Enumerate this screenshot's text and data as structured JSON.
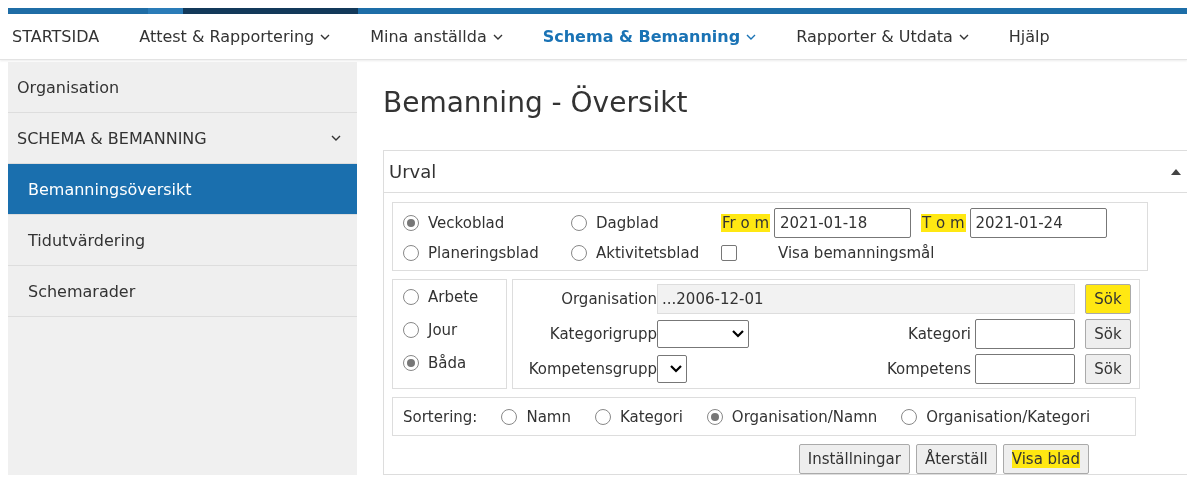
{
  "nav": [
    {
      "label": "STARTSIDA",
      "caret": false,
      "selected": false
    },
    {
      "label": "Attest & Rapportering",
      "caret": true,
      "selected": false
    },
    {
      "label": "Mina anställda",
      "caret": true,
      "selected": false
    },
    {
      "label": "Schema & Bemanning",
      "caret": true,
      "selected": true
    },
    {
      "label": "Rapporter & Utdata",
      "caret": true,
      "selected": false
    },
    {
      "label": "Hjälp",
      "caret": false,
      "selected": false
    }
  ],
  "sidebar": {
    "items": [
      {
        "label": "Organisation",
        "kind": "item",
        "selected": false
      },
      {
        "label": "SCHEMA & BEMANNING",
        "kind": "section",
        "expanded": true,
        "selected": false
      },
      {
        "label": "Bemanningsöversikt",
        "kind": "sub",
        "selected": true
      },
      {
        "label": "Tidutvärdering",
        "kind": "sub",
        "selected": false
      },
      {
        "label": "Schemarader",
        "kind": "sub",
        "selected": false
      }
    ]
  },
  "page_title": "Bemanning - Översikt",
  "panel": {
    "title": "Urval",
    "expanded": true,
    "sheet_types": [
      {
        "label": "Veckoblad",
        "selected": true
      },
      {
        "label": "Dagblad",
        "selected": false
      },
      {
        "label": "Planeringsblad",
        "selected": false
      },
      {
        "label": "Aktivitetsblad",
        "selected": false
      }
    ],
    "show_goal": {
      "label": "Visa bemanningsmål",
      "checked": false
    },
    "from": {
      "label": "Fr o m",
      "highlighted": true,
      "value": "2021-01-18"
    },
    "to": {
      "label": "T o m",
      "highlighted": true,
      "value": "2021-01-24"
    },
    "work_types": [
      {
        "label": "Arbete",
        "selected": false
      },
      {
        "label": "Jour",
        "selected": false
      },
      {
        "label": "Båda",
        "selected": true
      }
    ],
    "organisation": {
      "label": "Organisation",
      "value": "...2006-12-01",
      "button": "Sök",
      "highlighted": true
    },
    "category_group": {
      "label": "Kategorigrupp"
    },
    "category": {
      "label": "Kategori",
      "button": "Sök",
      "highlighted": false
    },
    "competence_group": {
      "label": "Kompetensgrupp"
    },
    "competence": {
      "label": "Kompetens",
      "button": "Sök",
      "highlighted": false
    },
    "sorting": {
      "label": "Sortering:",
      "options": [
        {
          "label": "Namn",
          "selected": false
        },
        {
          "label": "Kategori",
          "selected": false
        },
        {
          "label": "Organisation/Namn",
          "selected": true
        },
        {
          "label": "Organisation/Kategori",
          "selected": false
        }
      ]
    },
    "buttons": [
      {
        "label": "Inställningar",
        "highlighted": false
      },
      {
        "label": "Återställ",
        "highlighted": false
      },
      {
        "label": "Visa blad",
        "highlighted": true
      }
    ]
  }
}
